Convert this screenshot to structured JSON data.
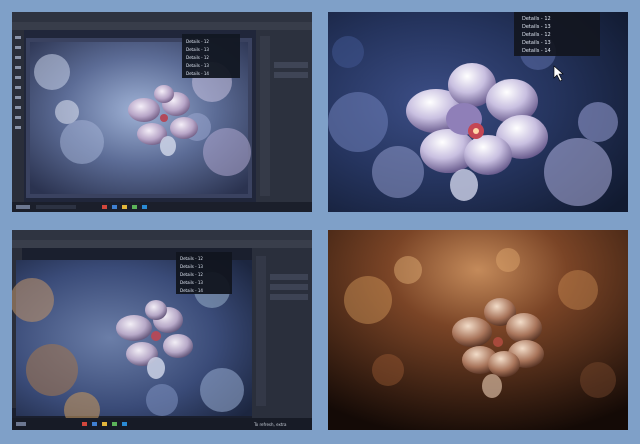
{
  "collage": {
    "background": "#7fa0c8",
    "panels": [
      {
        "name": "monitor-photo-editor-top-left"
      },
      {
        "name": "closeup-blue-flower-top-right"
      },
      {
        "name": "monitor-photo-editor-bottom-left"
      },
      {
        "name": "closeup-warm-flower-bottom-right"
      }
    ]
  },
  "dropdown_p1": {
    "items": [
      "Details - 12",
      "Details - 13",
      "Details - 12",
      "Details - 13",
      "Details - 14"
    ]
  },
  "dropdown_p2": {
    "items": [
      "Details - 12",
      "Details - 13",
      "Details - 12",
      "Details - 13",
      "Details - 14"
    ]
  },
  "dropdown_p3": {
    "items": [
      "Details - 12",
      "Details - 13",
      "Details - 12",
      "Details - 13",
      "Details - 14"
    ]
  },
  "taskbar_p3": {
    "notice": "To refresh, extra"
  }
}
